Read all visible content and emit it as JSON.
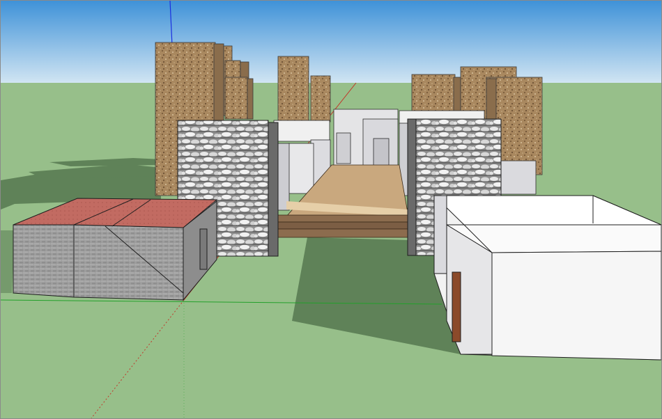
{
  "window": {
    "title": ""
  },
  "scene": {
    "colors": {
      "sky_top": "#3c8fd6",
      "sky_bottom": "#cfe3f2",
      "ground": "#97bf8a",
      "shadow": "#5d7f56",
      "stone_light": "#e8e8e8",
      "stone_dark": "#2c2c2c",
      "wall_white": "#f4f4f4",
      "wall_grey": "#cfcfd3",
      "roof_red": "#c06a62",
      "brick_grey": "#9c9c9c",
      "sandstone": "#a8875e",
      "deck_wood": "#c8a77c",
      "step_wood": "#8c6c4e",
      "door_brown": "#8b4a2a",
      "axis_red": "#c0392b",
      "axis_green": "#22a02a",
      "axis_blue": "#1a2ee0"
    }
  }
}
